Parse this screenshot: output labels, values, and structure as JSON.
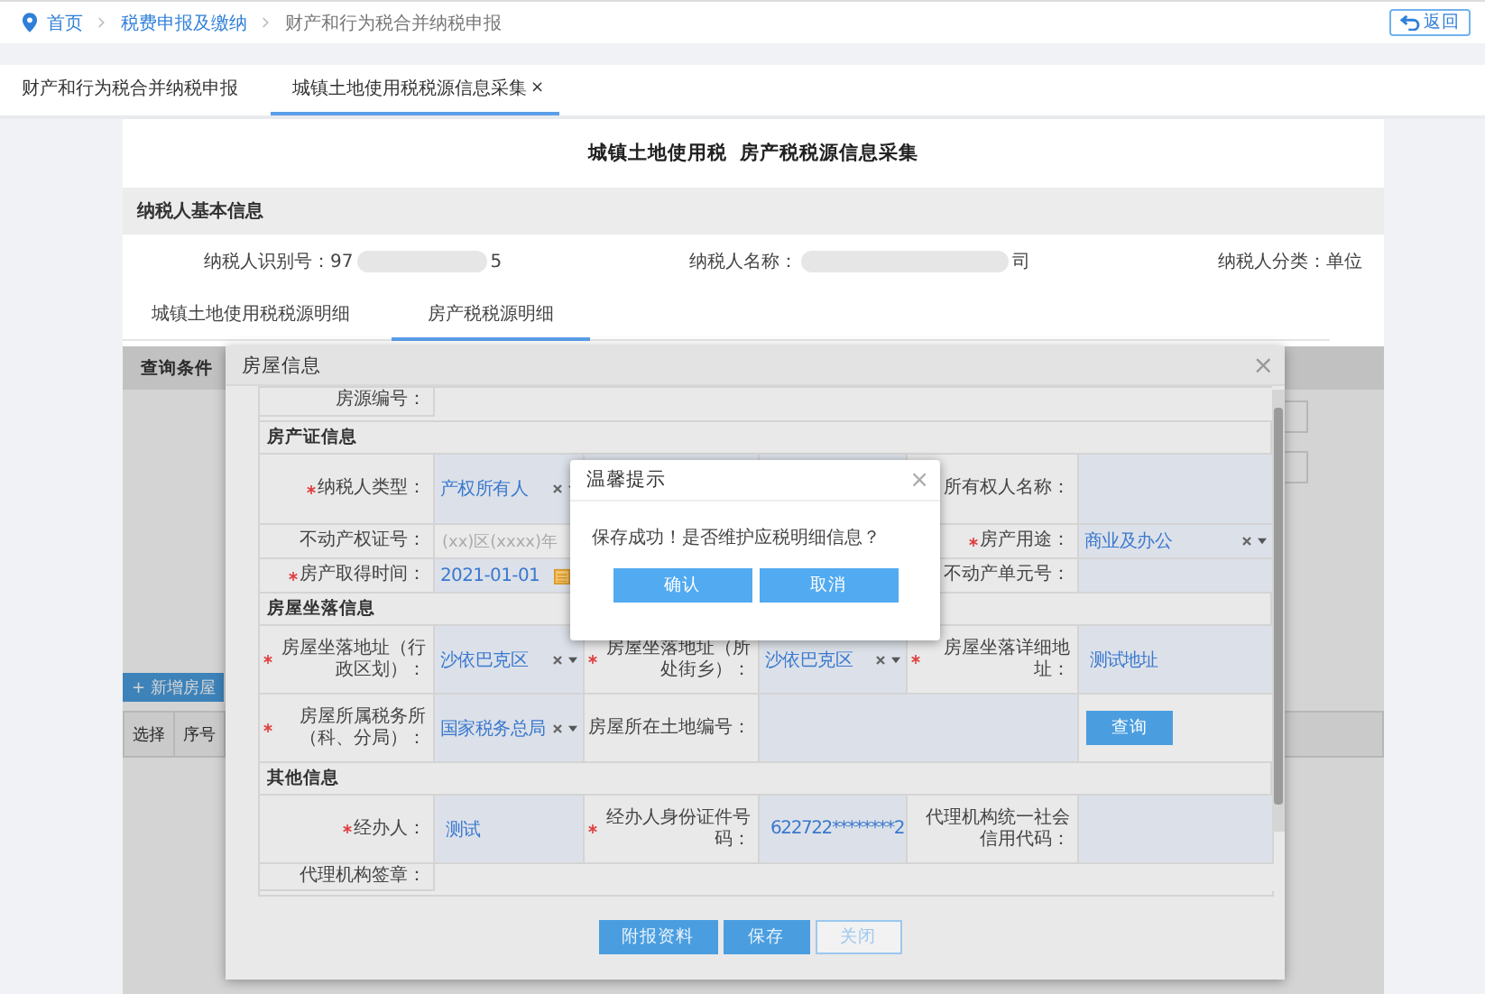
{
  "breadcrumb": [
    {
      "label": "首页",
      "kind": "home"
    },
    {
      "label": "税费申报及缴纳",
      "kind": "link"
    },
    {
      "label": "财产和行为税合并纳税申报",
      "kind": "current"
    }
  ],
  "back_button": "返回",
  "tabs": [
    {
      "label": "财产和行为税合并纳税申报",
      "selected": false
    },
    {
      "label": "城镇土地使用税税源信息采集",
      "selected": true,
      "close_mark": "×"
    }
  ],
  "page_title": "城镇土地使用税  房产税税源信息采集",
  "taxpayer_section": {
    "title": "纳税人基本信息",
    "fields": [
      {
        "label": "纳税人识别号：",
        "value_start": "97",
        "value_end": "5",
        "redacted": true
      },
      {
        "label": "纳税人名称：",
        "value_end": "司",
        "redacted": true
      },
      {
        "label": "纳税人分类：",
        "value_end": "单位",
        "redacted": false
      }
    ]
  },
  "sub_tabs": [
    {
      "label": "城镇土地使用税税源明细",
      "selected": false
    },
    {
      "label": "房产税税源明细",
      "selected": true
    }
  ],
  "list_page": {
    "query_title": "查询条件",
    "add_button": "+ 新增房屋",
    "columns": [
      "选择",
      "序号"
    ]
  },
  "modal": {
    "title": "房屋信息",
    "close_mark": "×",
    "rows": [
      {
        "kind": "full",
        "cells": [
          {
            "kind": "label",
            "text": "房源编号：",
            "required": false
          },
          {
            "kind": "full-field"
          }
        ]
      },
      {
        "kind": "section",
        "title": "房产证信息"
      },
      {
        "kind": "split",
        "cells": [
          {
            "kind": "label",
            "text": "纳税人类型：",
            "required": true
          },
          {
            "kind": "select",
            "value": "产权所有人"
          },
          {
            "kind": "label",
            "text": "所有权人名称：",
            "required": false
          },
          {
            "kind": "field"
          }
        ]
      },
      {
        "kind": "split",
        "cells": [
          {
            "kind": "label",
            "text": "不动产权证号：",
            "required": false
          },
          {
            "kind": "input",
            "placeholder": "(xx)区(xxxx)年"
          },
          {
            "kind": "label",
            "text": "房产用途：",
            "required": true
          },
          {
            "kind": "select",
            "value": "商业及办公"
          }
        ]
      },
      {
        "kind": "split",
        "cells": [
          {
            "kind": "label",
            "text": "房产取得时间：",
            "required": true
          },
          {
            "kind": "date",
            "value": "2021-01-01"
          },
          {
            "kind": "label",
            "text": "不动产单元号：",
            "required": false
          },
          {
            "kind": "field"
          }
        ]
      },
      {
        "kind": "section",
        "title": "房屋坐落信息"
      },
      {
        "kind": "triple",
        "cells": [
          {
            "kind": "label",
            "text": "房屋坐落地址（行政区划）：",
            "required": true
          },
          {
            "kind": "select",
            "value": "沙依巴克区"
          },
          {
            "kind": "label",
            "text": "房屋坐落地址（所处街乡）：",
            "required": true
          },
          {
            "kind": "select",
            "value": "沙依巴克区"
          },
          {
            "kind": "label",
            "text": "房屋坐落详细地址：",
            "required": true
          },
          {
            "kind": "text",
            "value": "测试地址"
          }
        ]
      },
      {
        "kind": "triple",
        "cells": [
          {
            "kind": "label",
            "text": "房屋所属税务所（科、分局）：",
            "required": true
          },
          {
            "kind": "select",
            "value": "国家税务总局"
          },
          {
            "kind": "label",
            "text": "房屋所在土地编号：",
            "required": false
          },
          {
            "kind": "wide-field"
          },
          {
            "kind": "button",
            "label": "查询"
          }
        ]
      },
      {
        "kind": "section",
        "title": "其他信息"
      },
      {
        "kind": "triple",
        "cells": [
          {
            "kind": "label",
            "text": "经办人：",
            "required": true
          },
          {
            "kind": "text",
            "value": "测试"
          },
          {
            "kind": "label",
            "text": "经办人身份证件号码：",
            "required": true
          },
          {
            "kind": "text",
            "value": "622722********2"
          },
          {
            "kind": "label",
            "text": "代理机构统一社会信用代码：",
            "required": false
          },
          {
            "kind": "field"
          }
        ]
      },
      {
        "kind": "full",
        "cells": [
          {
            "kind": "label",
            "text": "代理机构签章：",
            "required": false
          },
          {
            "kind": "full-field"
          }
        ]
      }
    ],
    "buttons": [
      {
        "label": "附报资料",
        "kind": "primary"
      },
      {
        "label": "保存",
        "kind": "primary"
      },
      {
        "label": "关闭",
        "kind": "secondary"
      }
    ]
  },
  "dialog": {
    "title": "温馨提示",
    "close_mark": "×",
    "message": "保存成功！是否维护应税明细信息？",
    "buttons": [
      "确认",
      "取消"
    ]
  }
}
